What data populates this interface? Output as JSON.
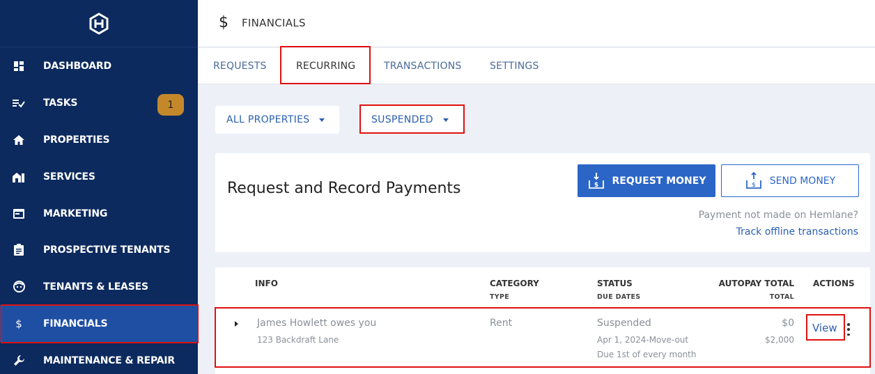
{
  "sidebar": {
    "items": [
      {
        "label": "DASHBOARD",
        "icon": "dashboard-icon"
      },
      {
        "label": "TASKS",
        "icon": "tasks-icon",
        "badge": "1"
      },
      {
        "label": "PROPERTIES",
        "icon": "home-icon"
      },
      {
        "label": "SERVICES",
        "icon": "services-icon"
      },
      {
        "label": "MARKETING",
        "icon": "marketing-icon"
      },
      {
        "label": "PROSPECTIVE TENANTS",
        "icon": "clipboard-icon"
      },
      {
        "label": "TENANTS & LEASES",
        "icon": "face-icon"
      },
      {
        "label": "FINANCIALS",
        "icon": "dollar-icon",
        "active": true
      },
      {
        "label": "MAINTENANCE & REPAIR",
        "icon": "wrench-icon"
      }
    ]
  },
  "header": {
    "icon_glyph": "$",
    "title": "FINANCIALS"
  },
  "tabs": [
    {
      "label": "REQUESTS"
    },
    {
      "label": "RECURRING",
      "active": true
    },
    {
      "label": "TRANSACTIONS"
    },
    {
      "label": "SETTINGS"
    }
  ],
  "filters": {
    "property": "ALL PROPERTIES",
    "status": "SUSPENDED"
  },
  "card": {
    "heading": "Request and Record Payments",
    "request_label": "REQUEST MONEY",
    "send_label": "SEND MONEY",
    "offline_note": "Payment not made on Hemlane?",
    "offline_link": "Track offline transactions"
  },
  "table": {
    "headers": {
      "info": "INFO",
      "category": "CATEGORY",
      "category_sub": "TYPE",
      "status": "STATUS",
      "status_sub": "DUE DATES",
      "autopay": "AUTOPAY TOTAL",
      "autopay_sub": "TOTAL",
      "actions": "ACTIONS"
    },
    "rows": [
      {
        "title": "James Howlett owes you",
        "address": "123 Backdraft Lane",
        "category": "Rent",
        "status": "Suspended",
        "dates": "Apr 1, 2024-Move-out",
        "schedule": "Due 1st of every month",
        "autopay": "$0",
        "total": "$2,000",
        "action": "View"
      }
    ]
  },
  "colors": {
    "sidebar_bg": "#0c2a5e",
    "sidebar_active": "#1e4fa3",
    "primary": "#2b66c7",
    "badge": "#c4882b",
    "highlight": "#e01010"
  }
}
